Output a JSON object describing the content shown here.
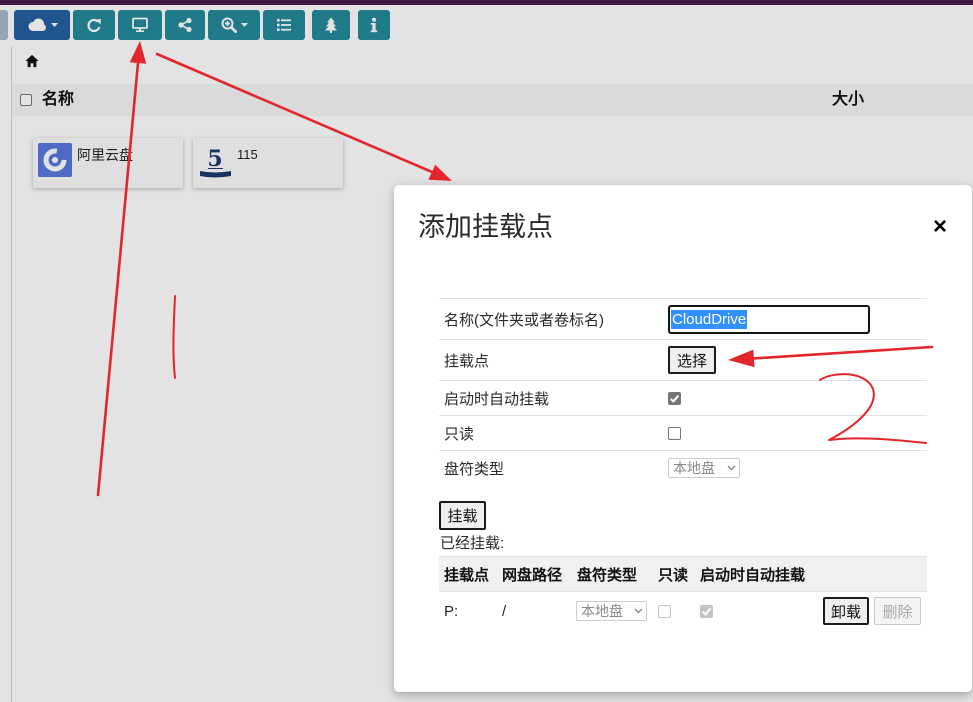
{
  "colors": {
    "top_bar": "#471a4a",
    "toolbar_blue": "#2660a2",
    "toolbar_teal": "#25899a",
    "annotation_red": "#e3262b",
    "selection": "#3390ff"
  },
  "toolbar": {
    "buttons": [
      {
        "icon": "cloud-icon",
        "has_caret": true
      },
      {
        "icon": "refresh-icon"
      },
      {
        "icon": "desktop-icon"
      },
      {
        "icon": "share-icon"
      },
      {
        "icon": "zoom-in-icon",
        "has_caret": true
      },
      {
        "icon": "list-icon"
      },
      {
        "icon": "tree-icon"
      },
      {
        "icon": "info-icon"
      }
    ]
  },
  "breadcrumb": {
    "icon": "home-icon"
  },
  "file_list": {
    "header": {
      "name": "名称",
      "size": "大小"
    },
    "items": [
      {
        "name": "阿里云盘",
        "icon": "aliyun-drive-logo"
      },
      {
        "name": "115",
        "icon": "115-logo",
        "logo_text": "5"
      }
    ]
  },
  "modal": {
    "title": "添加挂载点",
    "close_label": "×",
    "form": {
      "name": {
        "label": "名称(文件夹或者卷标名)",
        "value": "CloudDrive"
      },
      "mount_point": {
        "label": "挂载点",
        "button": "选择"
      },
      "auto_mount": {
        "label": "启动时自动挂载",
        "checked": true
      },
      "read_only": {
        "label": "只读",
        "checked": false
      },
      "drive_type": {
        "label": "盘符类型",
        "value": "本地盘"
      }
    },
    "mount_button": "挂载",
    "mounted_heading": "已经挂载:",
    "mounted_table": {
      "headers": [
        "挂载点",
        "网盘路径",
        "盘符类型",
        "只读",
        "启动时自动挂载"
      ],
      "rows": [
        {
          "mount_point": "P:",
          "cloud_path": "/",
          "drive_type": "本地盘",
          "read_only": false,
          "auto_mount": true,
          "unmount": "卸载",
          "delete": "删除"
        }
      ]
    }
  },
  "annotations": {
    "marks": [
      "1",
      "2"
    ]
  }
}
